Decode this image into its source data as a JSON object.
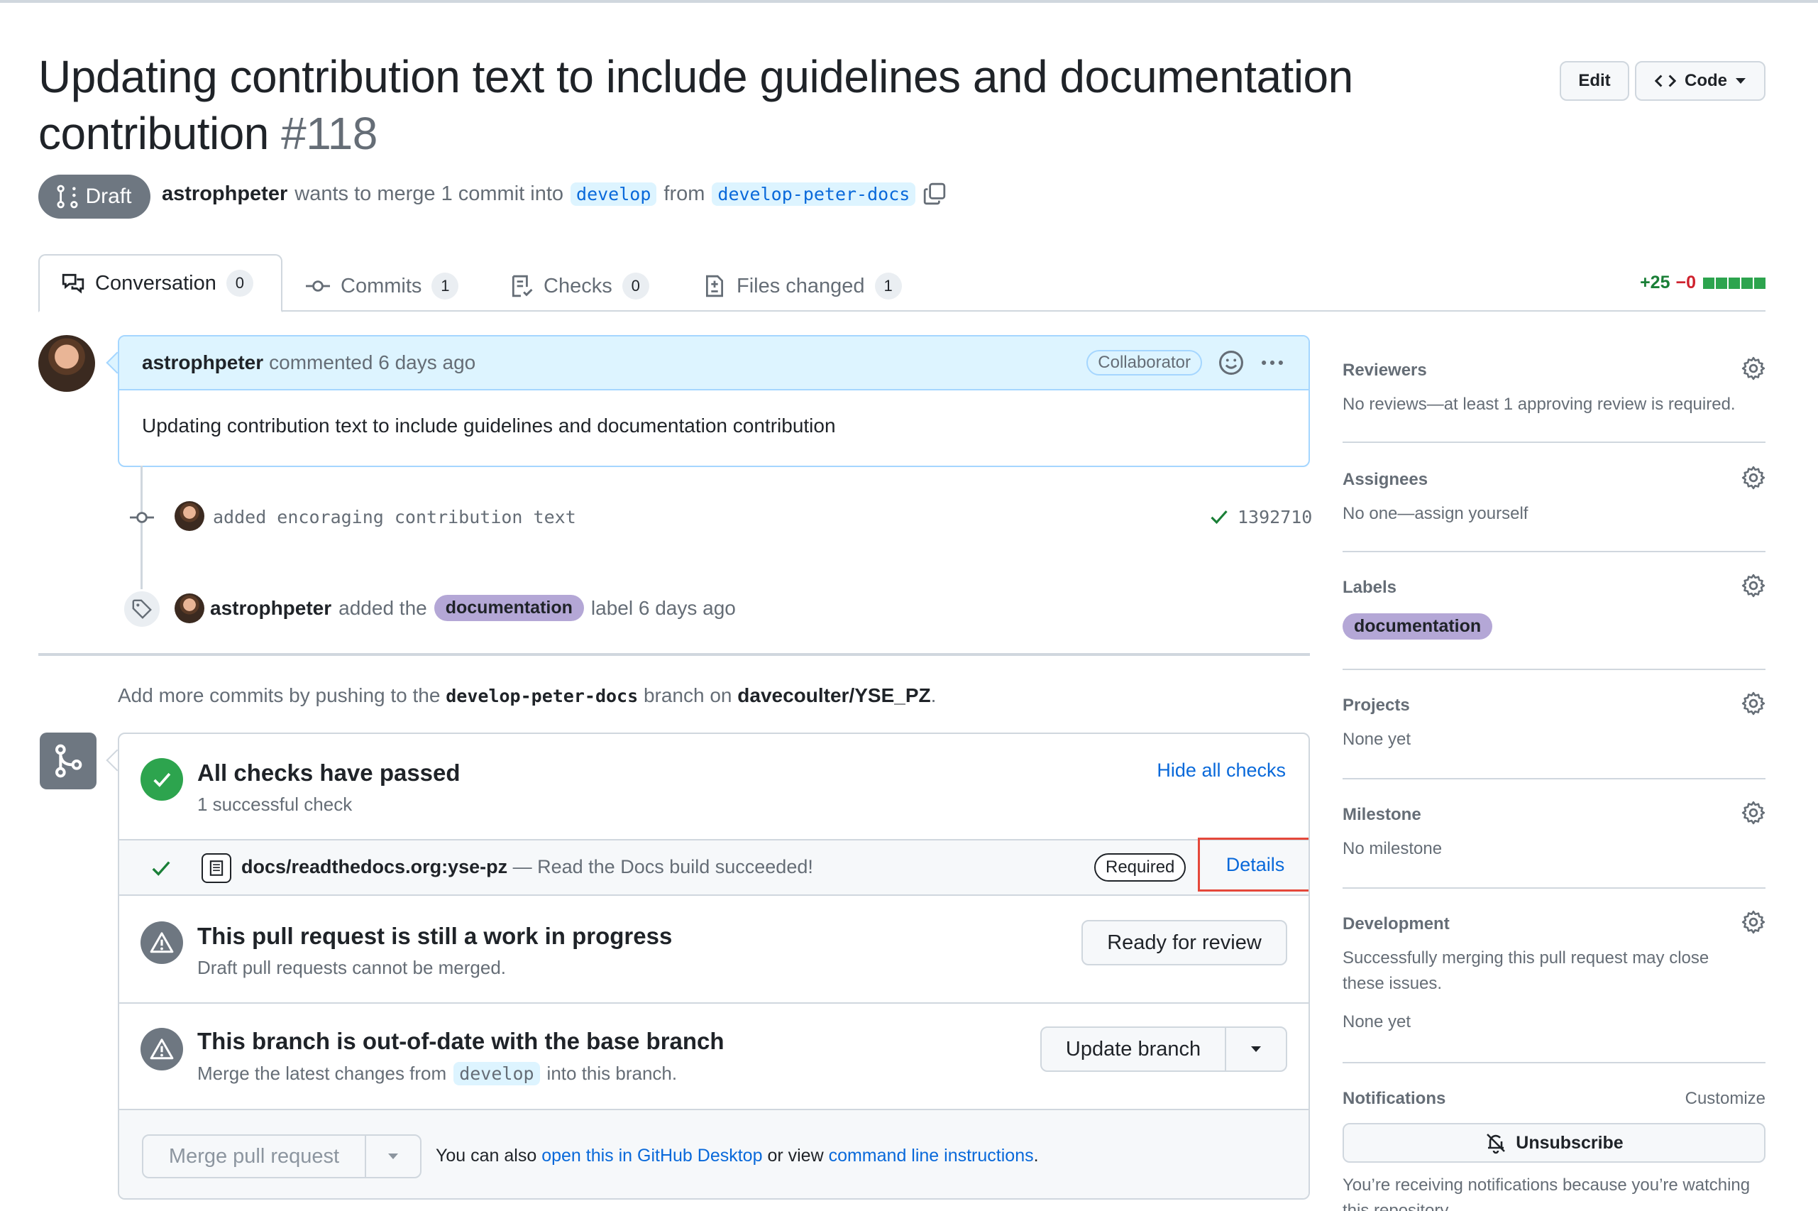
{
  "header": {
    "title": "Updating contribution text to include guidelines and documentation contribution",
    "number": "#118",
    "edit_label": "Edit",
    "code_label": "Code",
    "draft_label": "Draft",
    "author": "astrophpeter",
    "merge_text": "wants to merge 1 commit into",
    "base_branch": "develop",
    "from_text": "from",
    "head_branch": "develop-peter-docs"
  },
  "tabs": [
    {
      "label": "Conversation",
      "count": "0"
    },
    {
      "label": "Commits",
      "count": "1"
    },
    {
      "label": "Checks",
      "count": "0"
    },
    {
      "label": "Files changed",
      "count": "1"
    }
  ],
  "diffstat": {
    "added": "+25",
    "removed": "−0"
  },
  "comment": {
    "author": "astrophpeter",
    "action": "commented 6 days ago",
    "role": "Collaborator",
    "body": "Updating contribution text to include guidelines and documentation contribution"
  },
  "commit": {
    "message": "added encoraging contribution text",
    "sha": "1392710"
  },
  "label_event": {
    "author": "astrophpeter",
    "added_text": "added the",
    "label": "documentation",
    "suffix": "label 6 days ago"
  },
  "push_hint": {
    "prefix": "Add more commits by pushing to the",
    "branch": "develop-peter-docs",
    "middle": "branch on",
    "repo": "davecoulter/YSE_PZ",
    "suffix": "."
  },
  "checks": {
    "title": "All checks have passed",
    "subtitle": "1 successful check",
    "hide_label": "Hide all checks",
    "check_name": "docs/readthedocs.org:yse-pz",
    "check_desc": "— Read the Docs build succeeded!",
    "required_label": "Required",
    "details_label": "Details"
  },
  "wip": {
    "title": "This pull request is still a work in progress",
    "subtitle": "Draft pull requests cannot be merged.",
    "button": "Ready for review"
  },
  "outdated": {
    "title": "This branch is out-of-date with the base branch",
    "sub_prefix": "Merge the latest changes from",
    "sub_branch": "develop",
    "sub_suffix": "into this branch.",
    "button": "Update branch"
  },
  "merge": {
    "button": "Merge pull request",
    "prefix": "You can also",
    "desktop_link": "open this in GitHub Desktop",
    "middle": "or view",
    "cli_link": "command line instructions",
    "suffix": "."
  },
  "sidebar": {
    "reviewers": {
      "title": "Reviewers",
      "value": "No reviews—at least 1 approving review is required."
    },
    "assignees": {
      "title": "Assignees",
      "value": "No one—assign yourself"
    },
    "labels": {
      "title": "Labels",
      "value": "documentation"
    },
    "projects": {
      "title": "Projects",
      "value": "None yet"
    },
    "milestone": {
      "title": "Milestone",
      "value": "No milestone"
    },
    "development": {
      "title": "Development",
      "value": "Successfully merging this pull request may close these issues.",
      "value2": "None yet"
    },
    "notifications": {
      "title": "Notifications",
      "customize": "Customize",
      "unsubscribe": "Unsubscribe",
      "note": "You’re receiving notifications because you’re watching this repository."
    }
  },
  "colors": {
    "accent": "#0969da",
    "success": "#2da44e",
    "danger": "#cf222e",
    "highlight_box": "#e5483a"
  }
}
